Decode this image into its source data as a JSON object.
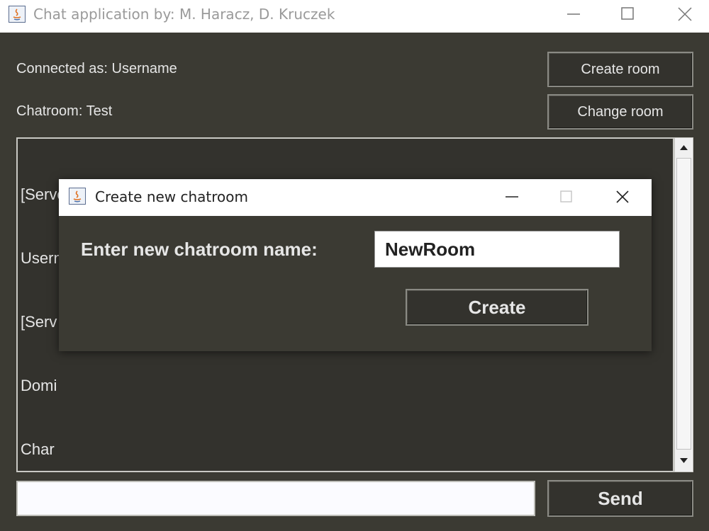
{
  "window": {
    "title": "Chat application by: M. Haracz, D. Kruczek"
  },
  "status": {
    "connected": "Connected as: Username",
    "chatroom": "Chatroom: Test"
  },
  "buttons": {
    "create_room": "Create room",
    "change_room": "Change room",
    "send": "Send"
  },
  "chat": {
    "lines": [
      "[Server]: Username joined!",
      "Username: Hello World",
      "[Serv",
      "Domi",
      "Char"
    ]
  },
  "message_input": {
    "value": ""
  },
  "dialog": {
    "title": "Create new chatroom",
    "label": "Enter new chatroom name:",
    "input_value": "NewRoom",
    "create_label": "Create"
  },
  "colors": {
    "background": "#3b3a33",
    "panel": "#33322d",
    "text": "#e6e6e6"
  }
}
